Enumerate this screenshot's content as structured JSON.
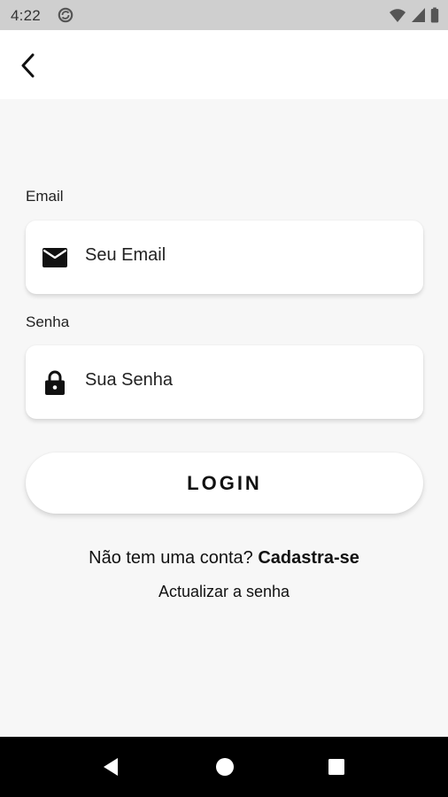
{
  "status_bar": {
    "time": "4:22",
    "icons": [
      "sync-icon",
      "wifi-icon",
      "signal-icon",
      "battery-icon"
    ]
  },
  "app_bar": {
    "back_icon": "chevron-left-icon"
  },
  "form": {
    "email_label": "Email",
    "email_placeholder": "Seu Email",
    "email_icon": "mail-icon",
    "password_label": "Senha",
    "password_placeholder": "Sua Senha",
    "password_icon": "lock-icon",
    "login_label": "LOGIN"
  },
  "links": {
    "signup_prompt": "Não tem uma conta?",
    "signup_action": "Cadastra-se",
    "reset_password": "Actualizar a senha"
  },
  "nav_bar": {
    "icons": [
      "nav-back-icon",
      "nav-home-icon",
      "nav-recent-icon"
    ]
  },
  "colors": {
    "background": "#f7f7f7",
    "status_bar": "#cfcfcf",
    "card": "#ffffff",
    "text": "#111111",
    "nav_bar": "#000000"
  }
}
